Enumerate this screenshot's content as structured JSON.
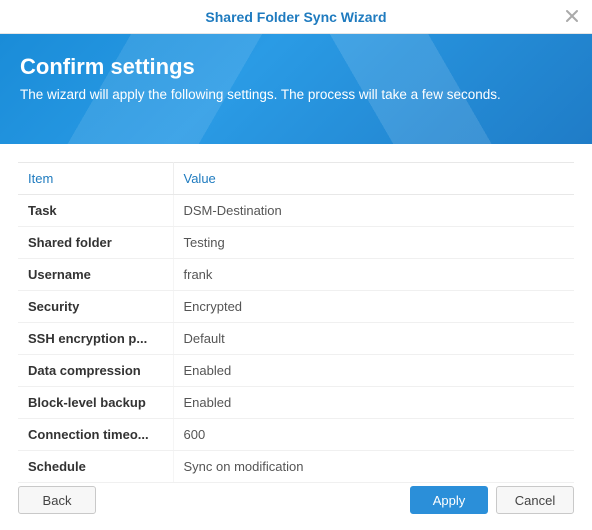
{
  "window": {
    "title": "Shared Folder Sync Wizard"
  },
  "banner": {
    "heading": "Confirm settings",
    "subtext": "The wizard will apply the following settings. The process will take a few seconds."
  },
  "table": {
    "col_item": "Item",
    "col_value": "Value",
    "rows": [
      {
        "key": "Task",
        "value": "DSM-Destination"
      },
      {
        "key": "Shared folder",
        "value": "Testing"
      },
      {
        "key": "Username",
        "value": "frank"
      },
      {
        "key": "Security",
        "value": "Encrypted"
      },
      {
        "key": "SSH encryption p...",
        "value": "Default"
      },
      {
        "key": "Data compression",
        "value": "Enabled"
      },
      {
        "key": "Block-level backup",
        "value": "Enabled"
      },
      {
        "key": "Connection timeo...",
        "value": "600"
      },
      {
        "key": "Schedule",
        "value": "Sync on modification"
      }
    ]
  },
  "buttons": {
    "back": "Back",
    "apply": "Apply",
    "cancel": "Cancel"
  }
}
